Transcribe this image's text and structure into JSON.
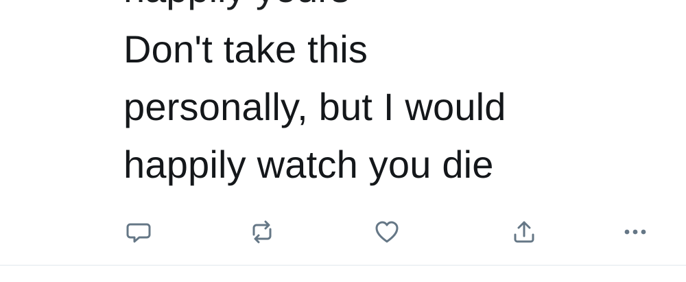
{
  "tweet": {
    "cut_line": "happily yours",
    "lines": [
      "Don't take this",
      "personally, but I would",
      "happily watch you die"
    ]
  },
  "actions": [
    {
      "name": "reply",
      "icon": "reply-icon"
    },
    {
      "name": "retweet",
      "icon": "retweet-icon"
    },
    {
      "name": "like",
      "icon": "heart-icon"
    },
    {
      "name": "share",
      "icon": "share-icon"
    },
    {
      "name": "more",
      "icon": "more-icon"
    }
  ],
  "colors": {
    "text": "#14171a",
    "icon": "#657786",
    "divider": "#e1e8ed"
  }
}
